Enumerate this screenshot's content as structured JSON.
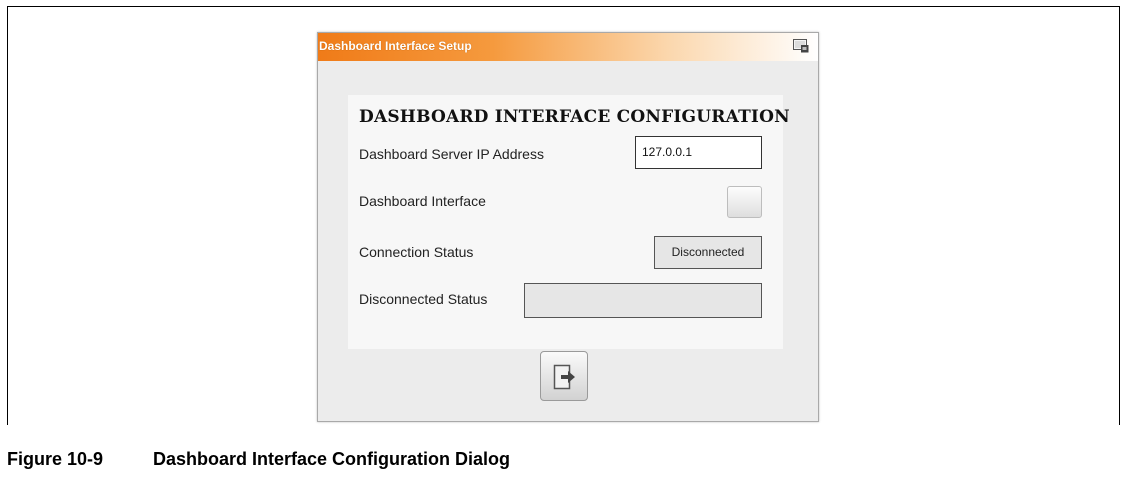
{
  "dialog": {
    "title": "Dashboard Interface Setup",
    "title_icon": "screen-icon",
    "header": "DASHBOARD INTERFACE CONFIGURATION",
    "rows": {
      "server_ip_label": "Dashboard Server IP Address",
      "server_ip_value": "127.0.0.1",
      "interface_label": "Dashboard Interface",
      "connection_status_label": "Connection Status",
      "connection_status_value": "Disconnected",
      "disconnected_status_label": "Disconnected Status",
      "disconnected_status_value": ""
    },
    "exit_icon": "exit-icon"
  },
  "figure": {
    "number": "Figure 10-9",
    "title": "Dashboard Interface Configuration Dialog"
  },
  "colors": {
    "titlebar_start": "#f07b18",
    "titlebar_end": "#ffffff",
    "panel_bg": "#f7f7f7",
    "dialog_bg": "#ececec"
  }
}
